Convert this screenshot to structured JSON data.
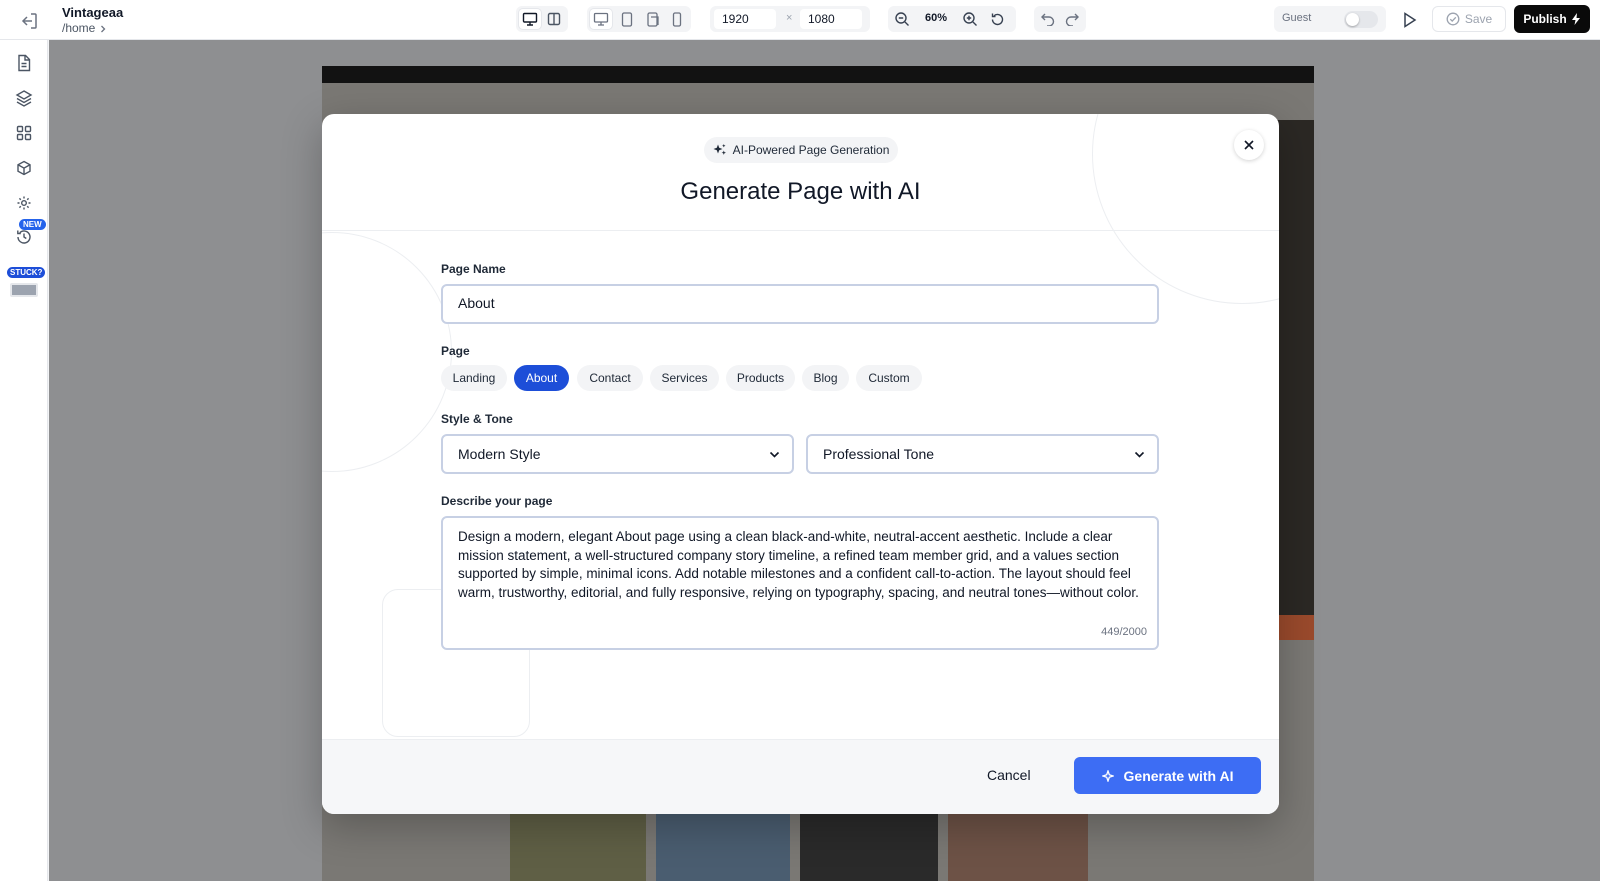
{
  "project": {
    "name": "Vintageaa",
    "path": "/home"
  },
  "toolbar": {
    "width": "1920",
    "height": "1080",
    "dimension_separator": "×",
    "zoom": "60%",
    "guest_label": "Guest",
    "save_label": "Save",
    "publish_label": "Publish"
  },
  "sidebar": {
    "new_badge": "NEW",
    "stuck_badge": "STUCK?"
  },
  "modal": {
    "pill_label": "AI-Powered Page Generation",
    "title": "Generate Page with AI",
    "page_name_label": "Page Name",
    "page_name_value": "About",
    "page_label": "Page",
    "page_types": [
      "Landing",
      "About",
      "Contact",
      "Services",
      "Products",
      "Blog",
      "Custom"
    ],
    "selected_page_type": "About",
    "style_tone_label": "Style & Tone",
    "style_value": "Modern Style",
    "tone_value": "Professional Tone",
    "describe_label": "Describe your page",
    "description": "Design a modern, elegant About page using a clean black-and-white, neutral-accent aesthetic. Include a clear mission statement, a well-structured company story timeline, a refined team member grid, and a values section supported by simple, minimal icons. Add notable milestones and a confident call-to-action. The layout should feel warm, trustworthy, editorial, and fully responsive, relying on typography, spacing, and neutral tones—without color.",
    "char_count": "449/2000",
    "cancel_label": "Cancel",
    "generate_label": "Generate with AI"
  },
  "colors": {
    "accent": "#1d4ed8",
    "generate_button": "#3d6df4",
    "publish_button": "#0a0a0a"
  }
}
